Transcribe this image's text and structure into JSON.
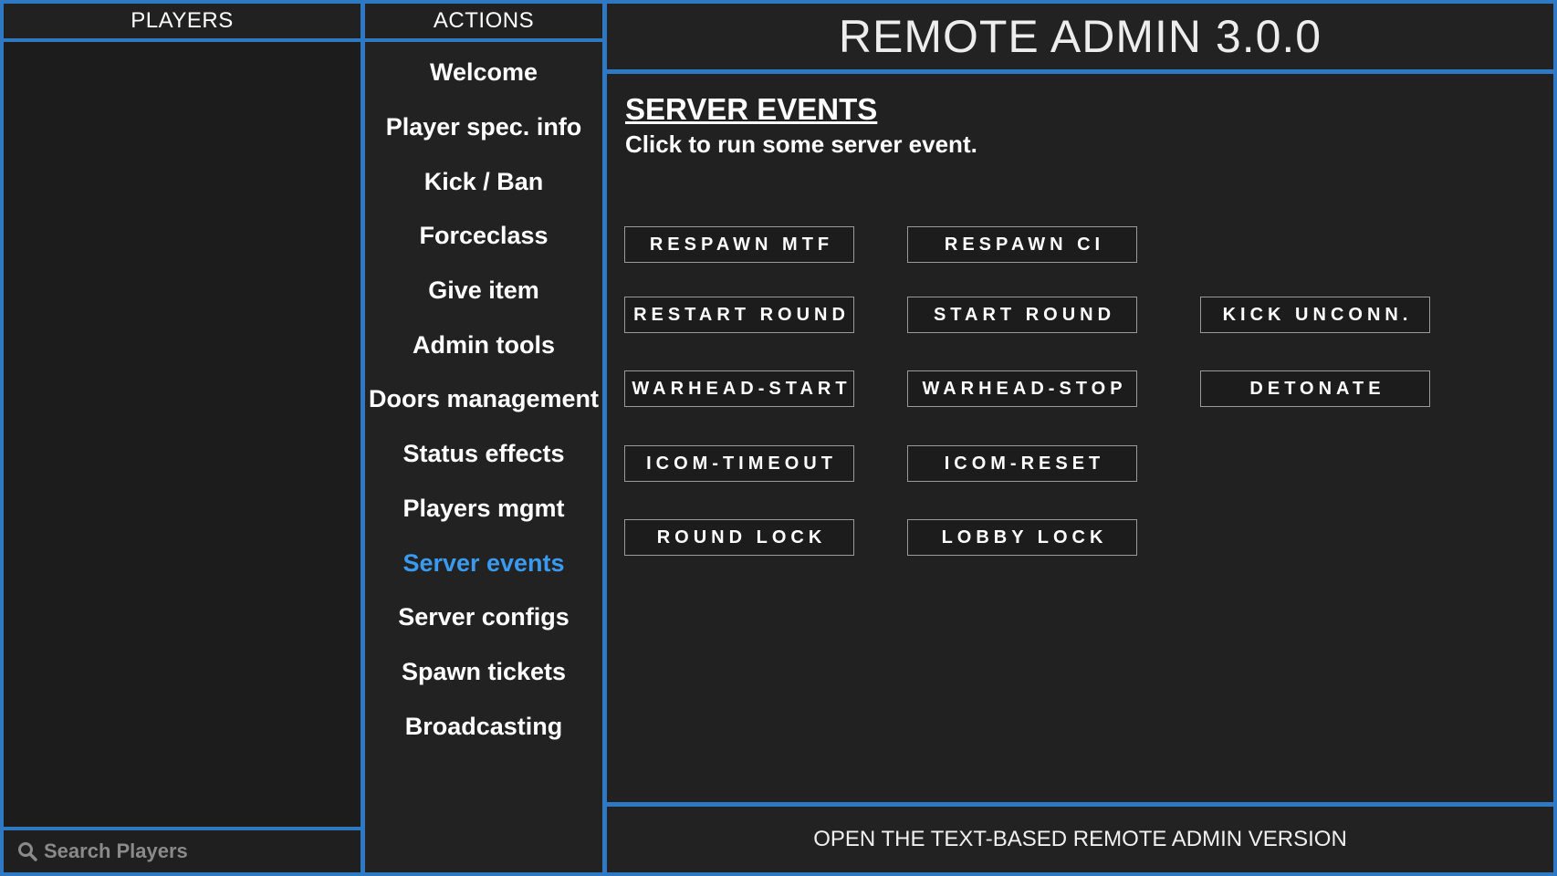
{
  "players": {
    "header": "PLAYERS",
    "search_placeholder": "Search Players",
    "search_icon": "search-icon"
  },
  "actions": {
    "header": "ACTIONS",
    "items": [
      {
        "label": "Welcome",
        "active": false
      },
      {
        "label": "Player spec. info",
        "active": false
      },
      {
        "label": "Kick / Ban",
        "active": false
      },
      {
        "label": "Forceclass",
        "active": false
      },
      {
        "label": "Give item",
        "active": false
      },
      {
        "label": "Admin tools",
        "active": false
      },
      {
        "label": "Doors management",
        "active": false
      },
      {
        "label": "Status effects",
        "active": false
      },
      {
        "label": "Players mgmt",
        "active": false
      },
      {
        "label": "Server events",
        "active": true
      },
      {
        "label": "Server configs",
        "active": false
      },
      {
        "label": "Spawn tickets",
        "active": false
      },
      {
        "label": "Broadcasting",
        "active": false
      }
    ]
  },
  "app_title": "REMOTE ADMIN 3.0.0",
  "content": {
    "title": "SERVER EVENTS",
    "subtitle": "Click to run some server event.",
    "buttons": {
      "respawn_mtf": "RESPAWN MTF",
      "respawn_ci": "RESPAWN CI",
      "restart_round": "RESTART ROUND",
      "start_round": "START ROUND",
      "kick_unconn": "KICK UNCONN.",
      "warhead_start": "WARHEAD-START",
      "warhead_stop": "WARHEAD-STOP",
      "detonate": "DETONATE",
      "icom_timeout": "ICOM-TIMEOUT",
      "icom_reset": "ICOM-RESET",
      "round_lock": "ROUND LOCK",
      "lobby_lock": "LOBBY LOCK"
    }
  },
  "footer": {
    "link_text": "OPEN THE TEXT-BASED REMOTE ADMIN VERSION"
  },
  "colors": {
    "accent_border": "#2f78c4",
    "active_item": "#3a9af0",
    "background": "#1f1f1f"
  }
}
